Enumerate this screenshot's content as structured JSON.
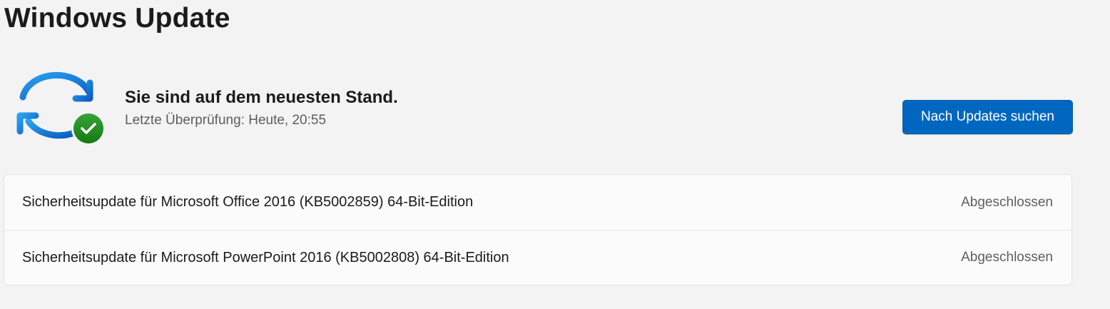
{
  "page": {
    "title": "Windows Update"
  },
  "status": {
    "icon": "sync-check-icon",
    "heading": "Sie sind auf dem neuesten Stand.",
    "last_checked": "Letzte Überprüfung: Heute, 20:55"
  },
  "actions": {
    "check_updates_label": "Nach Updates suchen"
  },
  "updates": [
    {
      "name": "Sicherheitsupdate für Microsoft Office 2016 (KB5002859) 64-Bit-Edition",
      "status": "Abgeschlossen"
    },
    {
      "name": "Sicherheitsupdate für Microsoft PowerPoint 2016 (KB5002808) 64-Bit-Edition",
      "status": "Abgeschlossen"
    }
  ],
  "colors": {
    "accent": "#0067c0",
    "check_badge": "#1e8a1e",
    "sync_arrows": "#1a86e0"
  }
}
